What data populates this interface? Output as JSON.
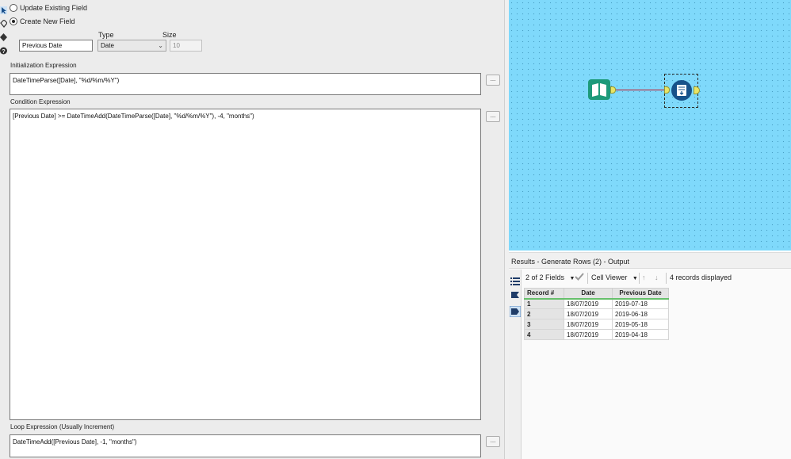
{
  "config": {
    "radio_update": "Update Existing Field",
    "radio_create": "Create New  Field",
    "type_label": "Type",
    "size_label": "Size",
    "field_name_value": "Previous Date",
    "type_value": "Date",
    "size_value": "10",
    "init_label": "Initialization Expression",
    "init_expr": "DateTimeParse([Date], \"%d/%m/%Y\")",
    "condition_label": "Condition Expression",
    "condition_expr": "[Previous Date] >= DateTimeAdd(DateTimeParse([Date], \"%d/%m/%Y\"), -4, \"months\")",
    "loop_label": "Loop Expression (Usually Increment)",
    "loop_expr": "DateTimeAdd([Previous Date], -1, \"months\")",
    "ellipsis": "..."
  },
  "results": {
    "title": "Results - Generate Rows (2) - Output",
    "fields_selector": "2 of 2 Fields",
    "cell_viewer": "Cell Viewer",
    "records_displayed": "4 records displayed",
    "columns": [
      "Record #",
      "Date",
      "Previous Date"
    ],
    "rows": [
      [
        "1",
        "18/07/2019",
        "2019-07-18"
      ],
      [
        "2",
        "18/07/2019",
        "2019-06-18"
      ],
      [
        "3",
        "18/07/2019",
        "2019-05-18"
      ],
      [
        "4",
        "18/07/2019",
        "2019-04-18"
      ]
    ]
  },
  "colors": {
    "canvas": "#7fd9fb",
    "input_tool": "#1d9a7a",
    "generate_tool": "#16528a",
    "connector": "#c0192b",
    "header_underline": "#66c06b"
  },
  "icons": [
    "pointer-icon",
    "tag-icon",
    "diamond-icon",
    "help-icon",
    "book-icon",
    "generate-rows-icon",
    "list-icon",
    "flag-icon",
    "tag-filled-icon",
    "checkmark-icon",
    "arrow-up-icon",
    "arrow-down-icon",
    "chevron-down-icon"
  ]
}
